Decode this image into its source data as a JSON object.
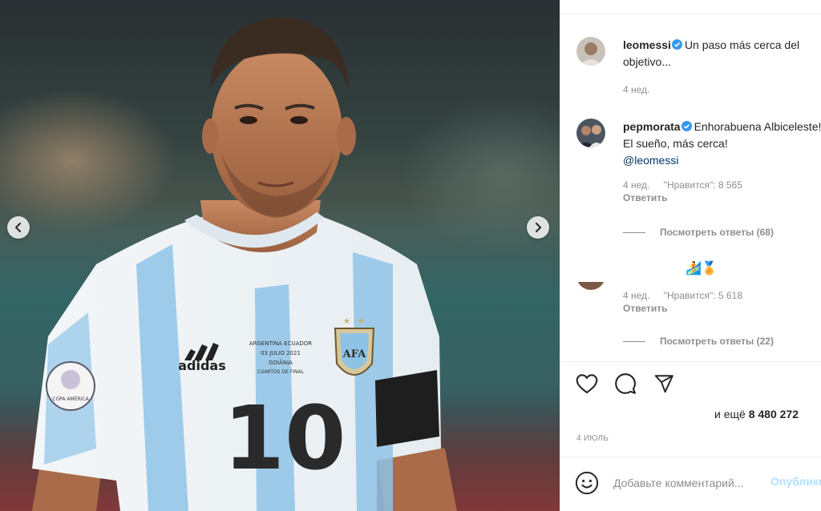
{
  "post": {
    "author": {
      "username": "leomessi",
      "verified": true,
      "caption": "Un paso más cerca del objetivo...",
      "time": "4 нед."
    },
    "comments": [
      {
        "username": "pepmorata",
        "verified": true,
        "text": "Enhorabuena Albiceleste! El sueño, más cerca!",
        "mention": "@leomessi",
        "time": "4 нед.",
        "likes": "\"Нравится\": 8 565",
        "reply_label": "Ответить",
        "view_replies": "Посмотреть ответы (68)"
      },
      {
        "username": "",
        "text": "🏄🏅",
        "time": "4 нед.",
        "likes": "\"Нравится\": 5 618",
        "reply_label": "Ответить",
        "view_replies": "Посмотреть ответы (22)"
      }
    ],
    "likes_prefix": "и ещё",
    "likes_count": "8 480 272",
    "date": "4 июль"
  },
  "add_comment": {
    "placeholder": "Добавьте комментарий...",
    "publish_label": "Опубликовать"
  },
  "jersey": {
    "number": "10",
    "brand": "adidas",
    "match_line1": "ARGENTINA  ECUADOR",
    "match_line2": "03 JULIO 2021",
    "match_line3": "GOIÂNIA",
    "match_line4": "CUARTOS DE FINAL",
    "crest": "AFA",
    "patch": "COPA AMÉRICA"
  },
  "colors": {
    "verified": "#3897f0",
    "link": "#00376b",
    "publish_disabled": "#b2dffc",
    "muted": "#8e8e8e"
  },
  "icons": [
    "chevron-left-icon",
    "chevron-right-icon",
    "verified-badge-icon",
    "heart-icon",
    "comment-icon",
    "share-icon",
    "emoji-icon"
  ]
}
